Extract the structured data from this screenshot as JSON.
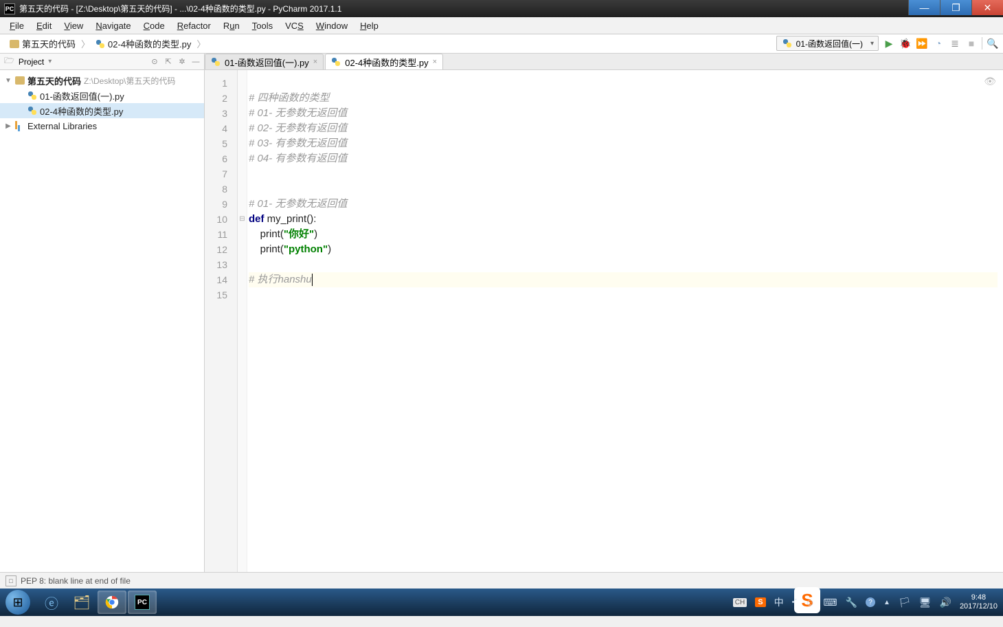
{
  "window": {
    "title": "第五天的代码 - [Z:\\Desktop\\第五天的代码] - ...\\02-4种函数的类型.py - PyCharm 2017.1.1"
  },
  "menu": {
    "items": [
      "File",
      "Edit",
      "View",
      "Navigate",
      "Code",
      "Refactor",
      "Run",
      "Tools",
      "VCS",
      "Window",
      "Help"
    ]
  },
  "breadcrumbs": {
    "root": "第五天的代码",
    "file": "02-4种函数的类型.py"
  },
  "run_config": {
    "selected": "01-函数返回值(一)"
  },
  "project_panel": {
    "title": "Project",
    "root_name": "第五天的代码",
    "root_path": "Z:\\Desktop\\第五天的代码",
    "files": [
      {
        "name": "01-函数返回值(一).py",
        "selected": false
      },
      {
        "name": "02-4种函数的类型.py",
        "selected": true
      }
    ],
    "external": "External Libraries"
  },
  "tabs": [
    {
      "name": "01-函数返回值(一).py",
      "active": false
    },
    {
      "name": "02-4种函数的类型.py",
      "active": true
    }
  ],
  "code": {
    "lines": [
      {
        "n": 1,
        "t": ""
      },
      {
        "n": 2,
        "t": "# 四种函数的类型",
        "cls": "comment"
      },
      {
        "n": 3,
        "t": "# 01- 无参数无返回值",
        "cls": "comment"
      },
      {
        "n": 4,
        "t": "# 02- 无参数有返回值",
        "cls": "comment"
      },
      {
        "n": 5,
        "t": "# 03- 有参数无返回值",
        "cls": "comment"
      },
      {
        "n": 6,
        "t": "# 04- 有参数有返回值",
        "cls": "comment"
      },
      {
        "n": 7,
        "t": ""
      },
      {
        "n": 8,
        "t": ""
      },
      {
        "n": 9,
        "t": "# 01- 无参数无返回值",
        "cls": "comment"
      },
      {
        "n": 10,
        "raw": "def_my_print"
      },
      {
        "n": 11,
        "raw": "print_nihao"
      },
      {
        "n": 12,
        "raw": "print_python"
      },
      {
        "n": 13,
        "t": ""
      },
      {
        "n": 14,
        "t": "# 执行hanshu",
        "cls": "comment",
        "hl": true,
        "caret": true
      },
      {
        "n": 15,
        "t": ""
      }
    ],
    "tokens": {
      "def": "def",
      "fn_name": "my_print",
      "print": "print",
      "str_nihao": "\"你好\"",
      "str_python": "\"python\""
    }
  },
  "statusbar": {
    "text": "PEP 8: blank line at end of file"
  },
  "taskbar": {
    "time": "9:48",
    "date": "2017/12/10",
    "ime_lang": "CH",
    "ime_mode": "中",
    "sogou": "S"
  }
}
